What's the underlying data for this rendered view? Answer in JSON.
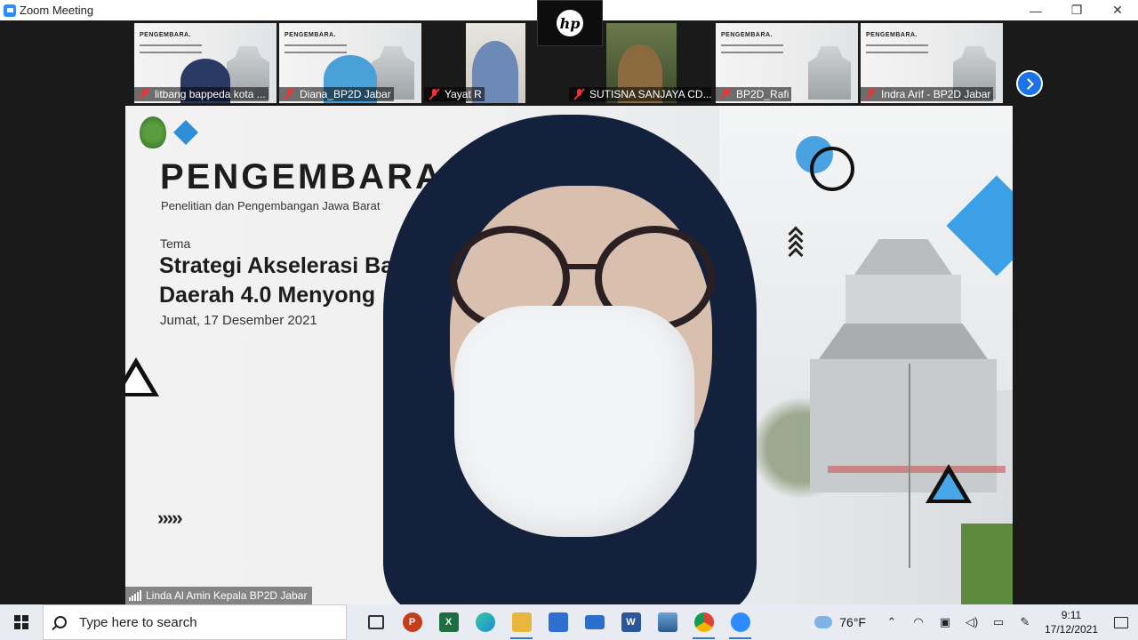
{
  "window": {
    "title": "Zoom Meeting",
    "minimize": "—",
    "restore": "❐",
    "close": "✕"
  },
  "participants": [
    {
      "name": "litbang bappeda kota ...",
      "muted": true,
      "kind": "slide"
    },
    {
      "name": "Diana_BP2D Jabar",
      "muted": true,
      "kind": "slide"
    },
    {
      "name": "Yayat R",
      "muted": true,
      "kind": "camera"
    },
    {
      "name": "SUTISNA SANJAYA CD...",
      "muted": true,
      "kind": "camera"
    },
    {
      "name": "BP2D_Rafi",
      "muted": true,
      "kind": "slide"
    },
    {
      "name": "Indra Arif - BP2D Jabar",
      "muted": true,
      "kind": "slide"
    }
  ],
  "thumb_slide": {
    "title": "PENGEMBARA."
  },
  "overlay": {
    "brand": "hp"
  },
  "main": {
    "speaker_name": "Linda Al Amin Kepala BP2D Jabar",
    "slide": {
      "title": "PENGEMBARA",
      "subtitle": "Penelitian dan Pengembangan Jawa Barat",
      "tema_label": "Tema",
      "strategy_line1": "Strategi Akselerasi Ba",
      "strategy_line2": "Daerah 4.0 Menyong",
      "date": "Jumat, 17 Desember 2021",
      "arrows": "›››››"
    }
  },
  "taskbar": {
    "search_placeholder": "Type here to search",
    "apps": [
      {
        "name": "task-view",
        "label": "",
        "color": "#e8ecf2"
      },
      {
        "name": "powerpoint",
        "label": "P",
        "color": "#c43e1c"
      },
      {
        "name": "excel",
        "label": "X",
        "color": "#1d6f42"
      },
      {
        "name": "edge",
        "label": "e",
        "color": "#1f8fd6"
      },
      {
        "name": "file-explorer",
        "label": "",
        "color": "#e8b63c"
      },
      {
        "name": "microsoft-store",
        "label": "",
        "color": "#2f6fd0"
      },
      {
        "name": "mail",
        "label": "",
        "color": "#2b6fce"
      },
      {
        "name": "word",
        "label": "W",
        "color": "#2b579a"
      },
      {
        "name": "photos",
        "label": "",
        "color": "#3a6ea8"
      },
      {
        "name": "chrome",
        "label": "",
        "color": "#dd4b39"
      },
      {
        "name": "zoom",
        "label": "",
        "color": "#2d8cff"
      }
    ],
    "weather": "76°F",
    "time": "9:11",
    "date": "17/12/2021"
  }
}
